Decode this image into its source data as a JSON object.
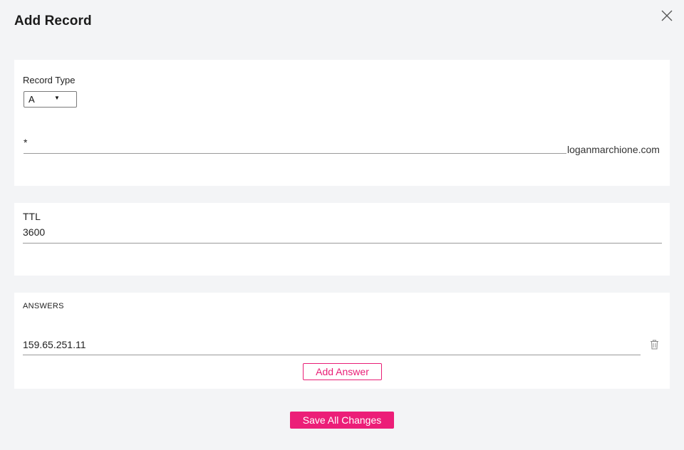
{
  "dialog": {
    "title": "Add Record",
    "close_icon": "close-icon"
  },
  "record_type": {
    "label": "Record Type",
    "selected": "A",
    "caret": "▼"
  },
  "host": {
    "value": "*",
    "domain_suffix": "loganmarchione.com"
  },
  "ttl": {
    "label": "TTL",
    "value": "3600"
  },
  "answers": {
    "heading": "ANSWERS",
    "items": [
      {
        "value": "159.65.251.11",
        "delete_icon": "trash-icon"
      }
    ],
    "add_label": "Add Answer"
  },
  "footer": {
    "save_label": "Save All Changes"
  },
  "colors": {
    "accent": "#ec1e78",
    "background": "#f3f4f6",
    "card": "#ffffff"
  }
}
